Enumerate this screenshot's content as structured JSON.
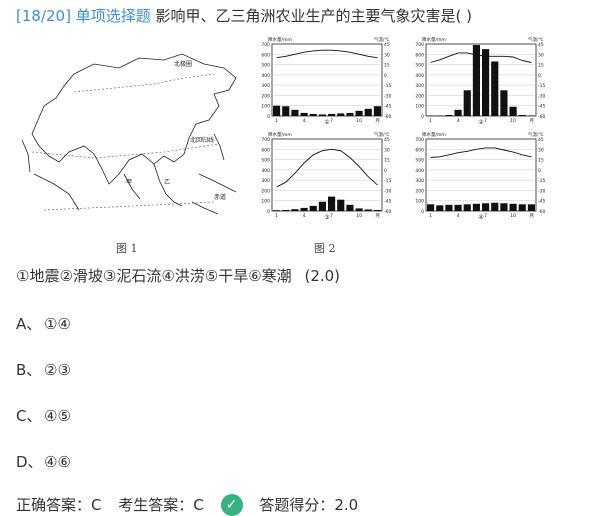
{
  "question": {
    "number": "[18/20]",
    "type": "单项选择题",
    "text": "影响甲、乙三角洲农业生产的主要气象灾害是( )"
  },
  "figure1": {
    "caption": "图 1",
    "labels": {
      "arctic_circle": "北极圈",
      "tropic_cancer": "北回归线",
      "equator": "赤道",
      "jia": "甲",
      "yi": "乙"
    }
  },
  "figure2": {
    "caption": "图 2",
    "ylabel_left": "降水量/mm",
    "ylabel_right": "气温/℃",
    "left_ticks": [
      "700",
      "600",
      "500",
      "400",
      "300",
      "200",
      "100",
      "0"
    ],
    "right_ticks": [
      "45",
      "30",
      "15",
      "0",
      "-15",
      "-30",
      "-45",
      "-60"
    ],
    "month_ticks": [
      "1",
      "4",
      "7",
      "10",
      "月"
    ],
    "panels": [
      {
        "label": "①",
        "precip": [
          100,
          95,
          60,
          30,
          20,
          15,
          20,
          25,
          30,
          50,
          70,
          95
        ],
        "temp": [
          25,
          27,
          30,
          33,
          35,
          36,
          36,
          35,
          33,
          30,
          27,
          25
        ]
      },
      {
        "label": "②",
        "precip": [
          5,
          5,
          10,
          60,
          250,
          690,
          650,
          530,
          250,
          90,
          10,
          5
        ],
        "temp": [
          18,
          22,
          27,
          32,
          32,
          29,
          27,
          27,
          27,
          26,
          21,
          18
        ]
      },
      {
        "label": "③",
        "precip": [
          8,
          10,
          18,
          30,
          50,
          90,
          140,
          110,
          60,
          25,
          15,
          10
        ],
        "temp": [
          -25,
          -18,
          -5,
          10,
          22,
          28,
          30,
          28,
          18,
          5,
          -10,
          -22
        ]
      },
      {
        "label": "④",
        "precip": [
          65,
          55,
          60,
          60,
          65,
          70,
          75,
          80,
          75,
          70,
          65,
          65
        ],
        "temp": [
          18,
          19,
          22,
          25,
          27,
          30,
          32,
          32,
          29,
          26,
          22,
          19
        ]
      }
    ]
  },
  "hazards": {
    "text": "①地震②滑坡③泥石流④洪涝⑤干旱⑥寒潮",
    "score": "(2.0)"
  },
  "options": [
    {
      "letter": "A、",
      "text": "①④"
    },
    {
      "letter": "B、",
      "text": "②③"
    },
    {
      "letter": "C、",
      "text": "④⑤"
    },
    {
      "letter": "D、",
      "text": "④⑥"
    }
  ],
  "footer": {
    "correct": "正确答案：C",
    "student": "考生答案：C",
    "check_icon": "✓",
    "score": "答题得分：2.0"
  }
}
